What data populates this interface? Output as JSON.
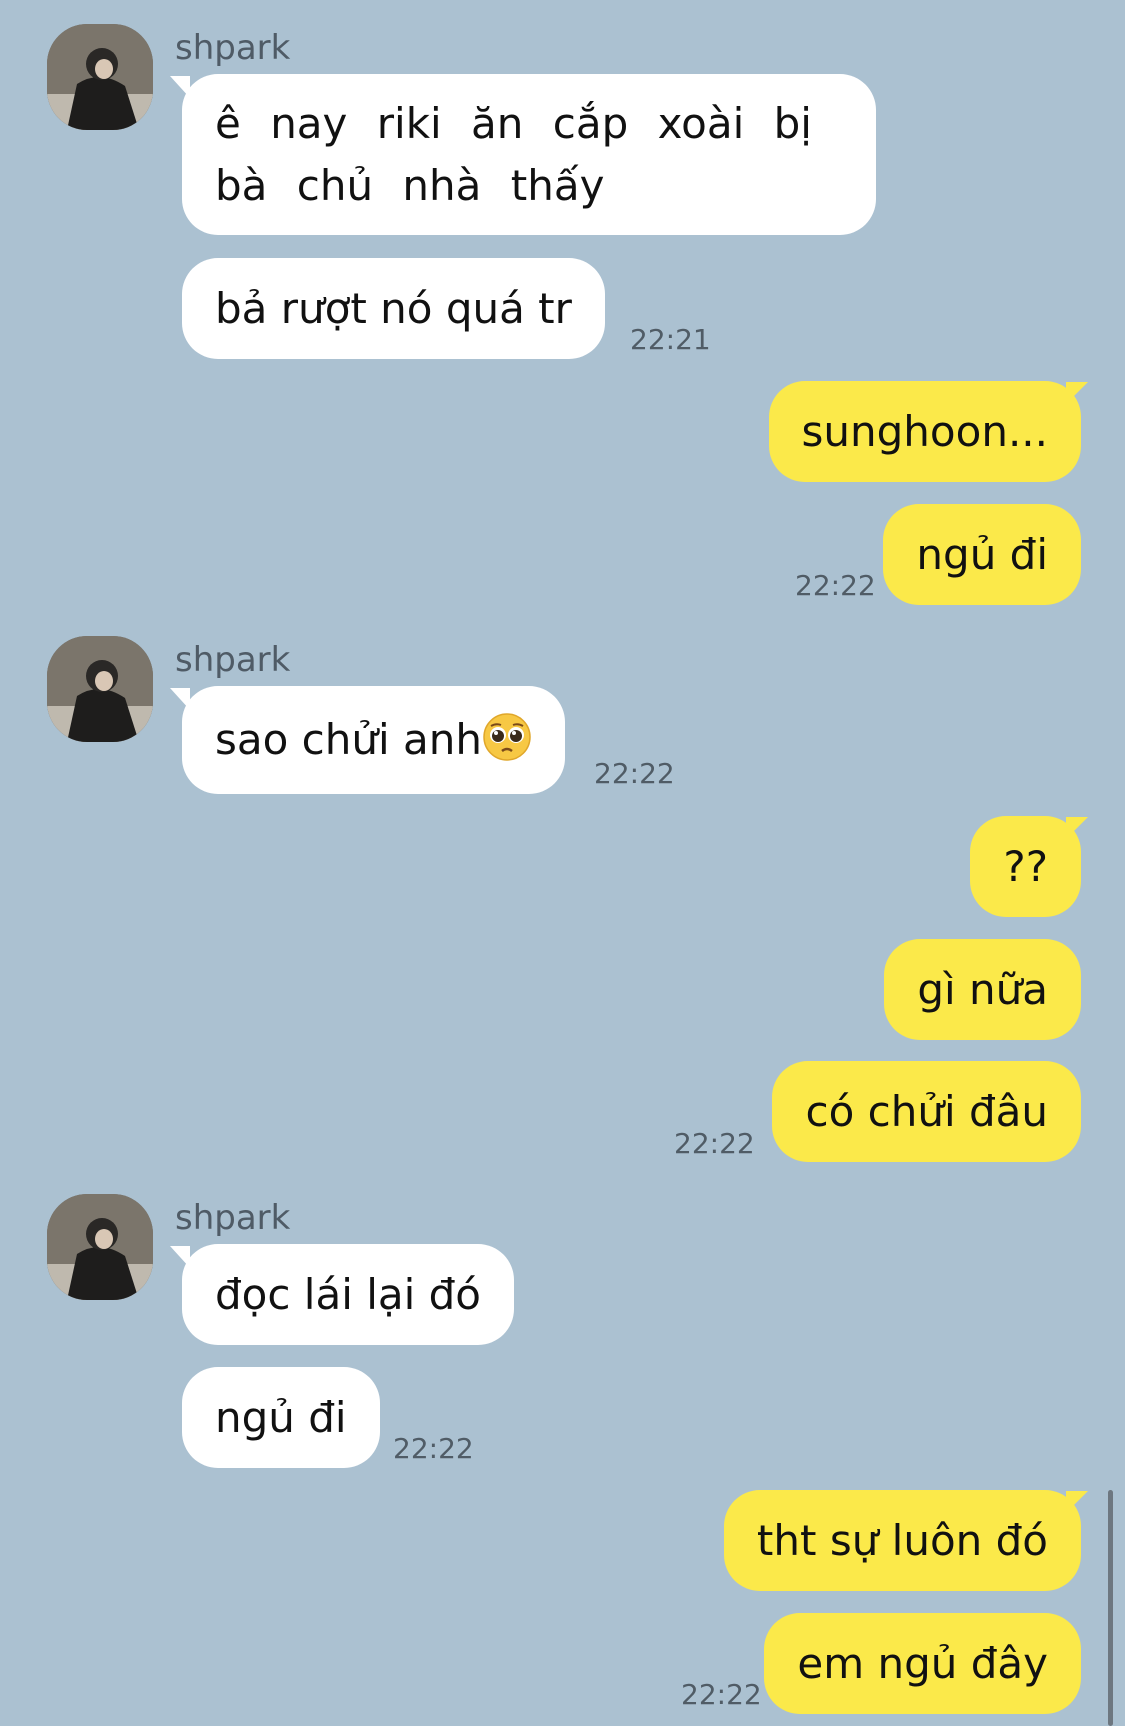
{
  "chat": {
    "sender_name": "shpark",
    "messages": [
      {
        "text": "ê nay riki ăn cắp xoài bị bà chủ nhà thấy"
      },
      {
        "text": "bả rượt nó quá tr",
        "time": "22:21"
      },
      {
        "text": "sunghoon..."
      },
      {
        "text": "ngủ đi",
        "time": "22:22"
      },
      {
        "text": "sao chửi anh",
        "time": "22:22",
        "emoji": "pleading-face-emoji"
      },
      {
        "text": "??"
      },
      {
        "text": "gì nữa"
      },
      {
        "text": "có chửi đâu",
        "time": "22:22"
      },
      {
        "text": "đọc lái lại đó"
      },
      {
        "text": "ngủ đi",
        "time": "22:22"
      },
      {
        "text": "tht sự luôn đó"
      },
      {
        "text": "em ngủ đây",
        "time": "22:22"
      }
    ]
  },
  "colors": {
    "background": "#abc1d1",
    "incoming_bubble": "#ffffff",
    "outgoing_bubble": "#fbe94a"
  }
}
